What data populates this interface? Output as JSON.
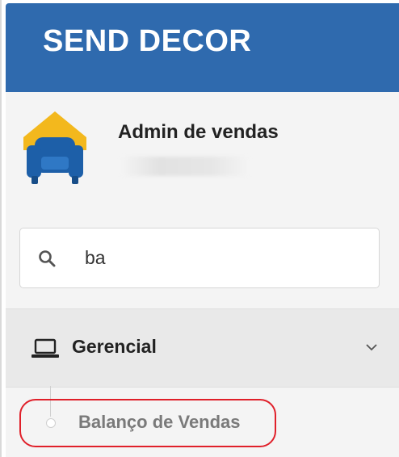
{
  "header": {
    "brand": "SEND DECOR",
    "color": "#2f6aae"
  },
  "profile": {
    "name": "Admin de vendas",
    "avatar_icon": "armchair-house-icon"
  },
  "search": {
    "value": "ba",
    "icon": "search-icon"
  },
  "menu": {
    "group": {
      "label": "Gerencial",
      "icon": "laptop-icon",
      "expand_icon": "chevron-down-icon"
    },
    "items": [
      {
        "label": "Balanço de Vendas",
        "icon": "circle-icon"
      }
    ]
  },
  "annotation": {
    "color": "#e0202a"
  }
}
